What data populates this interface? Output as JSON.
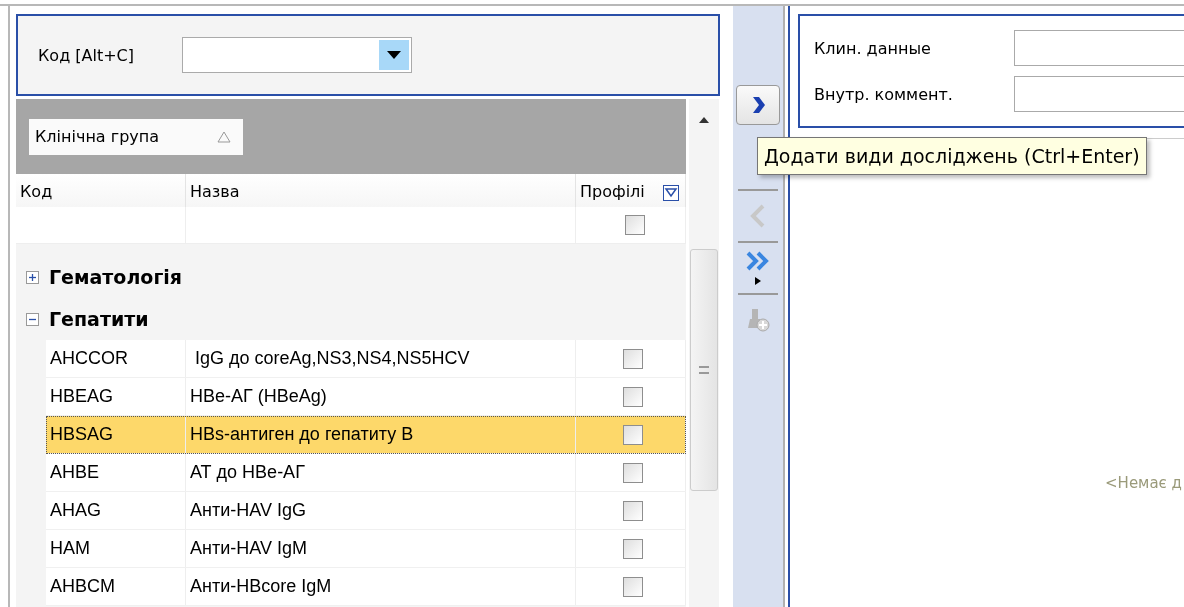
{
  "code_filter": {
    "label": "Код [Alt+C]"
  },
  "grid": {
    "group_by": {
      "label": "Клінічна група",
      "sorted_ascending": true
    },
    "columns": [
      "Код",
      "Назва",
      "Профілі"
    ],
    "filter_row": {
      "checked": false
    },
    "groups": [
      {
        "name": "Гематологія",
        "expanded": false
      },
      {
        "name": "Гепатити",
        "expanded": true,
        "rows": [
          {
            "code": "AHCCOR",
            "name": " IgG до coreAg,NS3,NS4,NS5HCV",
            "checked": false,
            "selected": false
          },
          {
            "code": "HBEAG",
            "name": "HBe-АГ (HBeAg)",
            "checked": false,
            "selected": false
          },
          {
            "code": "HBSAG",
            "name": "HBs-антиген до гепатиту В",
            "checked": false,
            "selected": true
          },
          {
            "code": "AHBE",
            "name": "АТ до HBe-АГ",
            "checked": false,
            "selected": false
          },
          {
            "code": "AHAG",
            "name": "Анти-HAV IgG",
            "checked": false,
            "selected": false
          },
          {
            "code": "HAM",
            "name": "Анти-HAV IgM",
            "checked": false,
            "selected": false
          },
          {
            "code": "AHBCM",
            "name": "Анти-HBcore IgM",
            "checked": false,
            "selected": false
          }
        ]
      }
    ]
  },
  "tool_strip": [
    {
      "kind": "add",
      "disabled": false
    },
    {
      "kind": "remove",
      "disabled": true
    },
    {
      "kind": "add_all",
      "disabled": false
    },
    {
      "kind": "flask",
      "disabled": true
    }
  ],
  "tooltip": "Додати види досліджень (Ctrl+Enter)",
  "form": {
    "fields": [
      {
        "label": "Клин. данные"
      },
      {
        "label": "Внутр. коммент."
      }
    ]
  },
  "selected_list": {
    "empty_text": "<Немає д"
  }
}
